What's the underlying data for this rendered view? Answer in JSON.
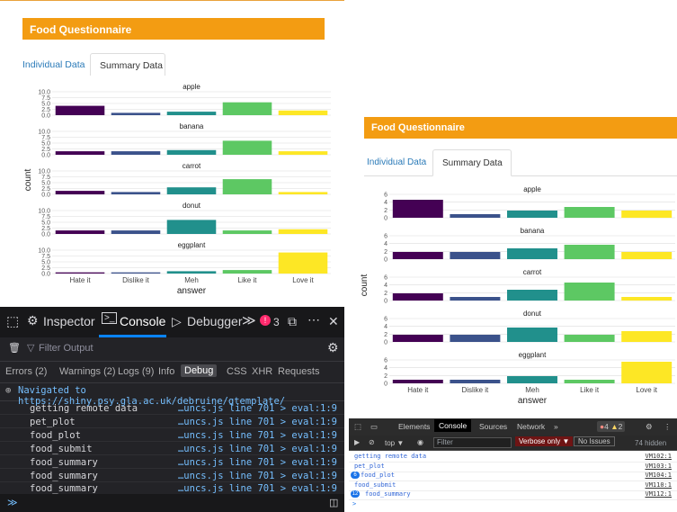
{
  "app": {
    "title": "Food Questionnaire",
    "tabs": [
      "Individual Data",
      "Summary Data"
    ],
    "active_tab": "Summary Data"
  },
  "chart_data": {
    "type": "bar",
    "faceted": true,
    "ylabel": "count",
    "xlabel": "answer",
    "categories": [
      "Hate it",
      "Dislike it",
      "Meh",
      "Like it",
      "Love it"
    ],
    "colors": [
      "#440154",
      "#3b528b",
      "#21908c",
      "#5dc863",
      "#fde725"
    ],
    "left_panel": {
      "yticks": [
        "10.0",
        "7.5",
        "5.0",
        "2.5",
        "0.0"
      ],
      "ymax": 10,
      "facets": [
        {
          "name": "apple",
          "values": [
            4,
            1,
            1.5,
            5.5,
            2
          ]
        },
        {
          "name": "banana",
          "values": [
            1.5,
            1.5,
            2,
            6,
            1.5
          ]
        },
        {
          "name": "carrot",
          "values": [
            1.5,
            1,
            3,
            6.5,
            1
          ]
        },
        {
          "name": "donut",
          "values": [
            1.5,
            1.5,
            6,
            1.5,
            2
          ]
        },
        {
          "name": "eggplant",
          "values": [
            0.5,
            0.5,
            1,
            1.5,
            9
          ]
        }
      ]
    },
    "right_panel": {
      "yticks": [
        "6",
        "4",
        "2",
        "0"
      ],
      "ymax": 6.5,
      "facets": [
        {
          "name": "apple",
          "values": [
            5,
            1,
            2,
            3,
            2
          ]
        },
        {
          "name": "banana",
          "values": [
            2,
            2,
            3,
            4,
            2
          ]
        },
        {
          "name": "carrot",
          "values": [
            2,
            1,
            3,
            5,
            1
          ]
        },
        {
          "name": "donut",
          "values": [
            2,
            2,
            4,
            2,
            3
          ]
        },
        {
          "name": "eggplant",
          "values": [
            1,
            1,
            2,
            1,
            6
          ]
        }
      ]
    }
  },
  "firefox_devtools": {
    "tools": [
      "Inspector",
      "Console",
      "Debugger"
    ],
    "active_tool": "Console",
    "more": "≫",
    "error_count": "3",
    "filter_placeholder": "Filter Output",
    "categories": [
      "Errors (2)",
      "Warnings (2)",
      "Logs (9)",
      "Info",
      "Debug",
      "CSS",
      "XHR",
      "Requests"
    ],
    "selected_category": "Debug",
    "navigated": "Navigated to https://shiny.psy.gla.ac.uk/debruine/qtemplate/",
    "logs": [
      {
        "msg": "getting remote data",
        "src": "…uncs.js line 701 > eval:1:9"
      },
      {
        "msg": "pet_plot",
        "src": "…uncs.js line 701 > eval:1:9"
      },
      {
        "msg": "food_plot",
        "src": "…uncs.js line 701 > eval:1:9"
      },
      {
        "msg": "food_submit",
        "src": "…uncs.js line 701 > eval:1:9"
      },
      {
        "msg": "food_summary",
        "src": "…uncs.js line 701 > eval:1:9"
      },
      {
        "msg": "food_summary",
        "src": "…uncs.js line 701 > eval:1:9"
      },
      {
        "msg": "food_summary",
        "src": "…uncs.js line 701 > eval:1:9"
      }
    ],
    "input_prompt": "≫"
  },
  "chrome_devtools": {
    "tabs": [
      "Elements",
      "Console",
      "Sources",
      "Network",
      "»"
    ],
    "active_tab": "Console",
    "errors": "4",
    "warnings": "2",
    "context": "top ▼",
    "filter_placeholder": "Filter",
    "levels": "Verbose only ▼",
    "issues": "No Issues",
    "hidden": "74 hidden",
    "logs": [
      {
        "msg": "getting remote data",
        "src": "VM102:1",
        "badge": ""
      },
      {
        "msg": "pet_plot",
        "src": "VM103:1",
        "badge": ""
      },
      {
        "msg": "food_plot",
        "src": "VM104:1",
        "badge": "6"
      },
      {
        "msg": "food_submit",
        "src": "VM110:1",
        "badge": ""
      },
      {
        "msg": "food_summary",
        "src": "VM112:1",
        "badge": "12"
      }
    ],
    "prompt": ">"
  }
}
